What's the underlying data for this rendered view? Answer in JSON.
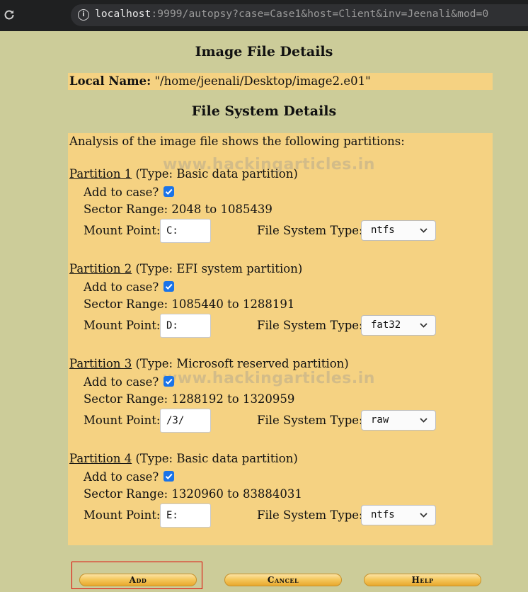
{
  "browser": {
    "url_host": "localhost",
    "url_rest": ":9999/autopsy?case=Case1&host=Client&inv=Jeenali&mod=0"
  },
  "image_details": {
    "heading": "Image File Details",
    "local_name_label": "Local Name:",
    "local_name_value": "\"/home/jeenali/Desktop/image2.e01\""
  },
  "fs_details": {
    "heading": "File System Details",
    "intro": "Analysis of the image file shows the following partitions:",
    "watermark": "www.hackingarticles.in"
  },
  "labels": {
    "add_to_case": "Add to case?",
    "mount_point": "Mount Point:",
    "fs_type": "File System Type:"
  },
  "partitions": [
    {
      "name": "Partition 1",
      "type": "(Type: Basic data partition)",
      "add": true,
      "sector_range": "Sector Range: 2048 to 1085439",
      "mount": "C:",
      "fs": "ntfs"
    },
    {
      "name": "Partition 2",
      "type": "(Type: EFI system partition)",
      "add": true,
      "sector_range": "Sector Range: 1085440 to 1288191",
      "mount": "D:",
      "fs": "fat32"
    },
    {
      "name": "Partition 3",
      "type": "(Type: Microsoft reserved partition)",
      "add": true,
      "sector_range": "Sector Range: 1288192 to 1320959",
      "mount": "/3/",
      "fs": "raw"
    },
    {
      "name": "Partition 4",
      "type": "(Type: Basic data partition)",
      "add": true,
      "sector_range": "Sector Range: 1320960 to 83884031",
      "mount": "E:",
      "fs": "ntfs"
    }
  ],
  "buttons": {
    "add": "Add",
    "cancel": "Cancel",
    "help": "Help"
  },
  "colors": {
    "page_bg": "#cccc99",
    "panel_bg": "#f5d282",
    "checkbox": "#1a73e8",
    "highlight": "#e00000"
  }
}
